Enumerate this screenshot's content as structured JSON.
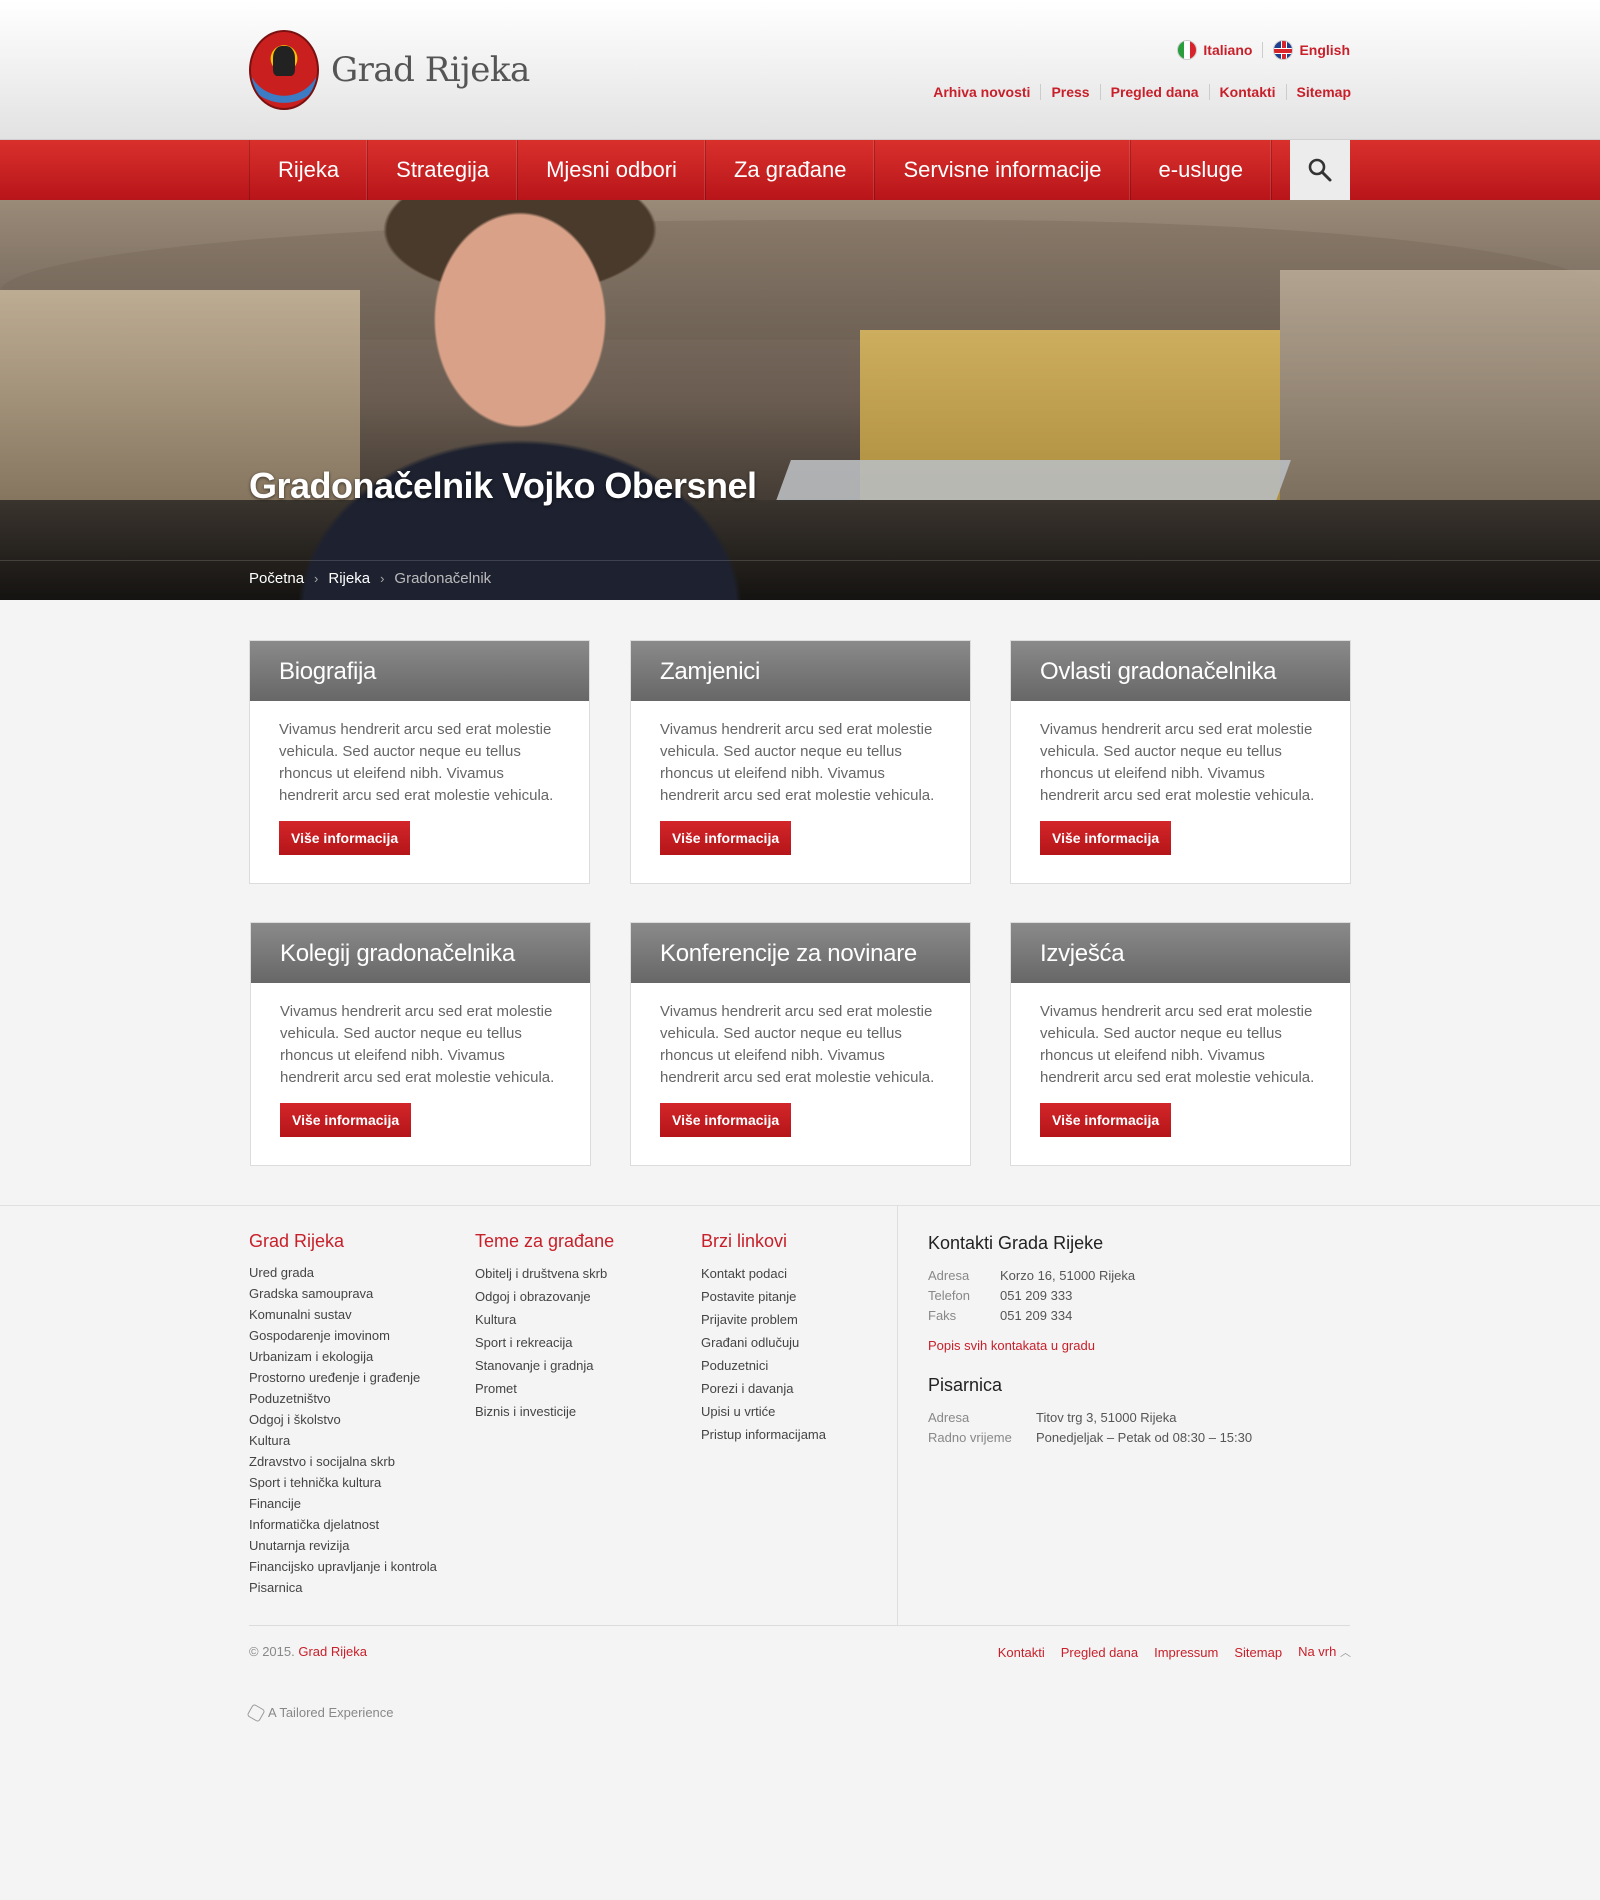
{
  "header": {
    "site_name": "Grad Rijeka",
    "languages": [
      {
        "label": "Italiano",
        "flag": "italy-flag-icon"
      },
      {
        "label": "English",
        "flag": "uk-flag-icon"
      }
    ],
    "top_links": [
      "Arhiva novosti",
      "Press",
      "Pregled dana",
      "Kontakti",
      "Sitemap"
    ]
  },
  "nav": {
    "items": [
      "Rijeka",
      "Strategija",
      "Mjesni odbori",
      "Za građane",
      "Servisne informacije",
      "e-usluge"
    ],
    "search_icon": "search-icon"
  },
  "hero": {
    "title": "Gradonačelnik Vojko Obersnel",
    "breadcrumb": [
      "Početna",
      "Rijeka",
      "Gradonačelnik"
    ]
  },
  "cards": [
    {
      "title": "Biografija",
      "text": "Vivamus hendrerit arcu sed erat molestie vehicula. Sed auctor neque eu tellus rhoncus ut eleifend nibh. Vivamus hendrerit arcu sed erat molestie vehicula.",
      "button": "Više informacija"
    },
    {
      "title": "Zamjenici",
      "text": "Vivamus hendrerit arcu sed erat molestie vehicula. Sed auctor neque eu tellus rhoncus ut eleifend nibh. Vivamus hendrerit arcu sed erat molestie vehicula.",
      "button": "Više informacija"
    },
    {
      "title": "Ovlasti gradonačelnika",
      "text": "Vivamus hendrerit arcu sed erat molestie vehicula. Sed auctor neque eu tellus rhoncus ut eleifend nibh. Vivamus hendrerit arcu sed erat molestie vehicula.",
      "button": "Više informacija"
    },
    {
      "title": "Kolegij gradonačelnika",
      "text": "Vivamus hendrerit arcu sed erat molestie vehicula. Sed auctor neque eu tellus rhoncus ut eleifend nibh. Vivamus hendrerit arcu sed erat molestie vehicula.",
      "button": "Više informacija"
    },
    {
      "title": "Konferencije za novinare",
      "text": "Vivamus hendrerit arcu sed erat molestie vehicula. Sed auctor neque eu tellus rhoncus ut eleifend nibh. Vivamus hendrerit arcu sed erat molestie vehicula.",
      "button": "Više informacija"
    },
    {
      "title": "Izvješća",
      "text": "Vivamus hendrerit arcu sed erat molestie vehicula. Sed auctor neque eu tellus rhoncus ut eleifend nibh. Vivamus hendrerit arcu sed erat molestie vehicula.",
      "button": "Više informacija"
    }
  ],
  "footer": {
    "columns": [
      {
        "title": "Grad Rijeka",
        "links": [
          "Ured grada",
          "Gradska samouprava",
          "Komunalni sustav",
          "Gospodarenje imovinom",
          "Urbanizam i ekologija",
          "Prostorno uređenje i građenje",
          "Poduzetništvo",
          "Odgoj i školstvo",
          "Kultura",
          "Zdravstvo i socijalna skrb",
          "Sport i tehnička kultura",
          "Financije",
          "Informatička djelatnost",
          "Unutarnja revizija",
          "Financijsko upravljanje i kontrola",
          "Pisarnica"
        ]
      },
      {
        "title": "Teme za građane",
        "links": [
          "Obitelj i društvena skrb",
          "Odgoj i obrazovanje",
          "Kultura",
          "Sport i rekreacija",
          "Stanovanje i gradnja",
          "Promet",
          "Biznis i investicije"
        ]
      },
      {
        "title": "Brzi linkovi",
        "links": [
          "Kontakt podaci",
          "Postavite pitanje",
          "Prijavite problem",
          "Građani odlučuju",
          "Poduzetnici",
          "Porezi i davanja",
          "Upisi u vrtiće",
          "Pristup informacijama"
        ]
      }
    ],
    "contacts": {
      "title": "Kontakti Grada Rijeke",
      "rows": [
        {
          "k": "Adresa",
          "v": "Korzo 16, 51000 Rijeka"
        },
        {
          "k": "Telefon",
          "v": "051 209 333"
        },
        {
          "k": "Faks",
          "v": "051 209 334"
        }
      ],
      "link": "Popis svih kontakata u gradu"
    },
    "pisarnica": {
      "title": "Pisarnica",
      "rows": [
        {
          "k": "Adresa",
          "v": "Titov trg 3, 51000 Rijeka"
        },
        {
          "k": "Radno vrijeme",
          "v": "Ponedjeljak – Petak od 08:30 – 15:30"
        }
      ]
    },
    "copyright_prefix": "© 2015.",
    "copyright_brand": "Grad Rijeka",
    "bottom_links": [
      "Kontakti",
      "Pregled dana",
      "Impressum",
      "Sitemap",
      "Na vrh"
    ],
    "tailored": "A Tailored Experience"
  },
  "colors": {
    "accent": "#c8202a",
    "card_header": "#777777"
  }
}
